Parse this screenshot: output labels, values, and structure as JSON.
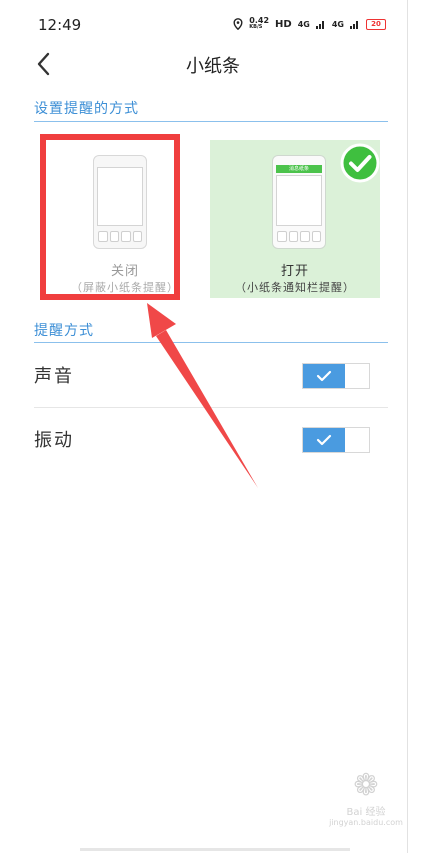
{
  "status_bar": {
    "time": "12:49",
    "net_speed_value": "0.42",
    "net_speed_unit": "KB/S",
    "hd_label": "HD",
    "signal_1": "4G",
    "signal_2": "4G",
    "battery": "20"
  },
  "nav": {
    "title": "小纸条",
    "back_icon": "chevron-left-icon"
  },
  "section_reminder_method": {
    "title": "设置提醒的方式",
    "options": [
      {
        "label": "关闭",
        "sub_label": "（屏蔽小纸条提醒）",
        "selected": false
      },
      {
        "label": "打开",
        "sub_label": "（小纸条通知栏提醒）",
        "selected": true,
        "notif_text": "消息纸条"
      }
    ]
  },
  "section_alert_type": {
    "title": "提醒方式",
    "rows": [
      {
        "label": "声音",
        "enabled": true
      },
      {
        "label": "振动",
        "enabled": true
      }
    ]
  },
  "watermark": {
    "text": "Bai 经验",
    "url": "jingyan.baidu.com"
  },
  "colors": {
    "accent": "#3d8fd6",
    "toggle_on": "#4a9be0",
    "selected_card_bg": "#dbf1d8",
    "check_green": "#3fbf3f",
    "highlight_red": "#f03e3e"
  }
}
